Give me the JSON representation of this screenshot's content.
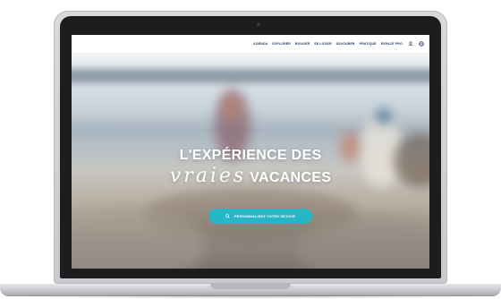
{
  "nav": {
    "items": [
      "AGENDA",
      "EXPLORER",
      "BOUGER",
      "SE LOGER",
      "SAVOURER",
      "PRATIQUE",
      "ESPACE PRO"
    ],
    "icons": [
      "user-icon",
      "globe-icon"
    ]
  },
  "hero": {
    "headline": "L'EXPÉRIENCE DES",
    "script_word": "vraies",
    "line2_word": "VACANCES",
    "cta_label": "PERSONNALISEZ VOTRE SÉJOUR",
    "scroll_icon": "arrow-down-icon"
  },
  "colors": {
    "nav_text": "#1f3a5c",
    "cta": "#27b6c6",
    "headline": "#ffffff"
  }
}
